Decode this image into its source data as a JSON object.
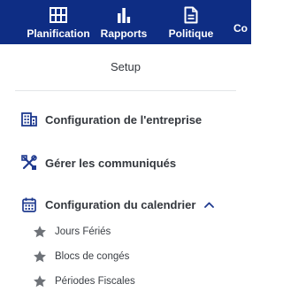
{
  "topnav": {
    "items": [
      {
        "label": "Planification",
        "icon": "grid-icon"
      },
      {
        "label": "Rapports",
        "icon": "bar-chart-icon"
      },
      {
        "label": "Politique",
        "icon": "document-icon"
      },
      {
        "label": "Co",
        "icon": ""
      }
    ]
  },
  "sidebar": {
    "title": "Setup",
    "items": [
      {
        "label": "Configuration de l'entreprise",
        "icon": "building-icon"
      },
      {
        "label": "Gérer les communiqués",
        "icon": "tools-icon"
      },
      {
        "label": "Configuration du calendrier",
        "icon": "calendar-icon",
        "expanded": true
      }
    ],
    "calendar_subitems": [
      {
        "label": "Jours Fériés",
        "icon": "star-icon"
      },
      {
        "label": "Blocs de congés",
        "icon": "star-icon"
      },
      {
        "label": "Périodes Fiscales",
        "icon": "star-icon"
      }
    ]
  },
  "colors": {
    "nav_background": "#0e2d84",
    "icon_blue": "#1f3a8f",
    "star_gray": "#6e7278"
  }
}
